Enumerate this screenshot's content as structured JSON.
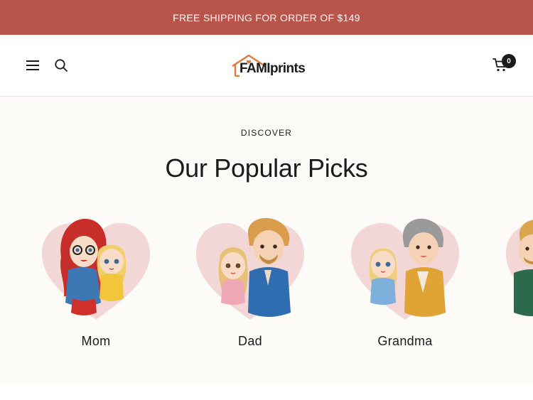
{
  "announcement": {
    "text": "FREE SHIPPING FOR ORDER OF $149"
  },
  "header": {
    "menu_icon": "hamburger-menu-icon",
    "search_icon": "search-icon",
    "logo": {
      "part1": "FAMI",
      "part2": "prints"
    },
    "cart_icon": "cart-icon",
    "cart_count": "0"
  },
  "discover": {
    "eyebrow": "DISCOVER",
    "title": "Our Popular Picks",
    "picks": [
      {
        "label": "Mom"
      },
      {
        "label": "Dad"
      },
      {
        "label": "Grandma"
      },
      {
        "label": ""
      }
    ]
  },
  "colors": {
    "announcement_bg": "#b9544b",
    "section_bg": "#fdfbf7",
    "heart_fill": "#f3d6d6",
    "logo_accent": "#e07a3a",
    "text": "#1c1b1b"
  }
}
